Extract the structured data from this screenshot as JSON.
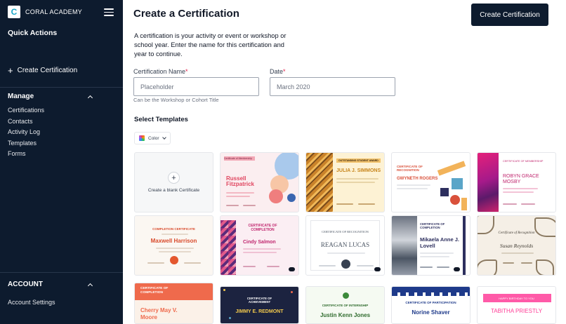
{
  "brand": {
    "name": "CORAL ACADEMY",
    "logo_letter": "C"
  },
  "sidebar": {
    "quick_actions_title": "Quick Actions",
    "create_certification": "Create Certification",
    "manage_title": "Manage",
    "manage_items": [
      "Certifications",
      "Contacts",
      "Activity Log",
      "Templates",
      "Forms"
    ],
    "account_title": "ACCOUNT",
    "account_items": [
      "Account Settings"
    ]
  },
  "main": {
    "title": "Create a Certification",
    "primary_button": "Create Certification",
    "description": "A certification is your activity or event or workshop or school year. Enter the name for this certification and year to continue.",
    "name_field": {
      "label": "Certification Name",
      "required_mark": "*",
      "placeholder": "Placeholder",
      "hint": "Can be the Workshop or Cohort Title"
    },
    "date_field": {
      "label": "Date",
      "required_mark": "*",
      "placeholder": "March 2020"
    },
    "select_templates_title": "Select Templates",
    "color_filter": "Color",
    "blank_template": "Create a blank Certificate"
  },
  "templates": [
    {
      "heading": "Certificate of Membership",
      "name": "Russell Fitzpatrick"
    },
    {
      "heading": "OUTSTANDING STUDENT AWARD",
      "name": "JULIA J. SIMMONS"
    },
    {
      "heading": "CERTIFICATE OF RECOGNITION",
      "name": "GWYNETH ROGERS"
    },
    {
      "heading": "CERTIFICATE OF MEMBERSHIP",
      "name": "ROBYN GRACE MOSBY"
    },
    {
      "heading": "COMPLETION CERTIFICATE",
      "name": "Maxwell Harrison"
    },
    {
      "heading": "CERTIFICATE OF COMPLETION",
      "name": "Cindy Salmon"
    },
    {
      "heading": "CERTIFICATE OF RECOGNITION",
      "name": "REAGAN LUCAS"
    },
    {
      "heading": "CERTIFICATE OF COMPLETION",
      "name": "Mikaela Anne J. Lovell"
    },
    {
      "heading": "Certificate of Recognition",
      "name": "Susan Reynolds"
    },
    {
      "heading": "CERTIFICATE OF COMPLETION",
      "name": "Cherry May V. Moore"
    },
    {
      "heading": "CERTIFICATE OF ACHIEVEMENT",
      "name": "JIMMY E. REDMONT"
    },
    {
      "heading": "CERTIFICATE OF INTERNSHIP",
      "name": "Justin Kenn Jones"
    },
    {
      "heading": "CERTIFICATE OF PARTICIPATION",
      "name": "Norine Shaver"
    },
    {
      "heading": "HAPPY BIRTHDAY TO YOU",
      "name": "TABITHA PRIESTLY"
    }
  ]
}
